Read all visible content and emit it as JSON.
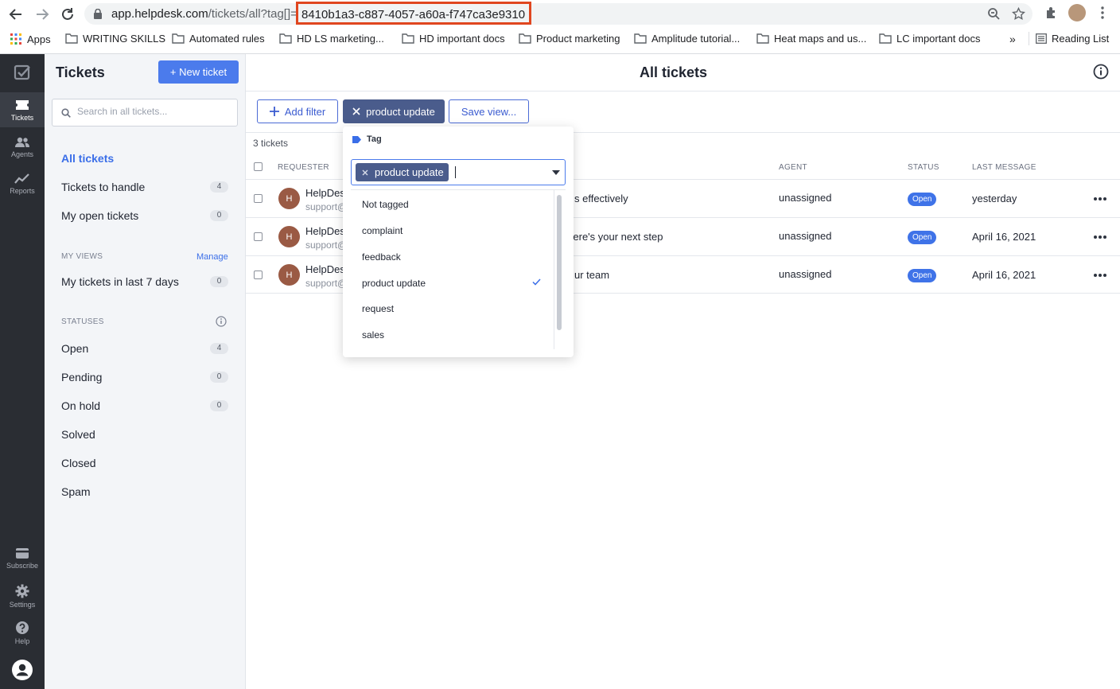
{
  "browser": {
    "url_domain": "app.helpdesk.com",
    "url_path": "/tickets/all?tag[]=",
    "url_highlight": "8410b1a3-c887-4057-a60a-f747ca3e9310",
    "bookmarks": [
      "Apps",
      "WRITING SKILLS",
      "Automated rules",
      "HD LS marketing...",
      "HD important docs",
      "Product marketing",
      "Amplitude tutorial...",
      "Heat maps and us...",
      "LC important docs",
      "Reading List"
    ],
    "more_label": "»"
  },
  "rail": {
    "items": [
      "Tickets",
      "Agents",
      "Reports",
      "Subscribe",
      "Settings",
      "Help"
    ]
  },
  "sidebar": {
    "title": "Tickets",
    "new_ticket": "+ New ticket",
    "search_placeholder": "Search in all tickets...",
    "links": [
      {
        "label": "All tickets",
        "count": ""
      },
      {
        "label": "Tickets to handle",
        "count": "4"
      },
      {
        "label": "My open tickets",
        "count": "0"
      }
    ],
    "my_views_label": "MY VIEWS",
    "manage": "Manage",
    "views": [
      {
        "label": "My tickets in last 7 days",
        "count": "0"
      }
    ],
    "statuses_label": "STATUSES",
    "statuses": [
      {
        "label": "Open",
        "count": "4"
      },
      {
        "label": "Pending",
        "count": "0"
      },
      {
        "label": "On hold",
        "count": "0"
      },
      {
        "label": "Solved",
        "count": ""
      },
      {
        "label": "Closed",
        "count": ""
      },
      {
        "label": "Spam",
        "count": ""
      }
    ]
  },
  "main": {
    "title": "All tickets",
    "add_filter": "Add filter",
    "active_filter": "product update",
    "save_view": "Save view...",
    "ticket_count": "3 tickets",
    "columns": {
      "requester": "REQUESTER",
      "agent": "AGENT",
      "status": "STATUS",
      "last_message": "LAST MESSAGE"
    },
    "rows": [
      {
        "initial": "H",
        "name": "HelpDes",
        "email": "support@",
        "subject": "s effectively",
        "agent": "unassigned",
        "status": "Open",
        "last": "yesterday"
      },
      {
        "initial": "H",
        "name": "HelpDes..",
        "email": "support@h",
        "subject": "Here's your next step",
        "agent": "unassigned",
        "status": "Open",
        "last": "April 16, 2021"
      },
      {
        "initial": "H",
        "name": "HelpDesk",
        "email": "support@h",
        "subject": "ur team",
        "agent": "unassigned",
        "status": "Open",
        "last": "April 16, 2021"
      }
    ]
  },
  "tag_popover": {
    "label": "Tag",
    "selected_chip": "product update",
    "options": [
      "Not tagged",
      "complaint",
      "feedback",
      "product update",
      "request",
      "sales"
    ],
    "checked": "product update"
  },
  "colors": {
    "accent": "#4b7bec",
    "rail": "#2a2d33",
    "chip": "#4a5c8c",
    "highlight": "#e0461f"
  }
}
